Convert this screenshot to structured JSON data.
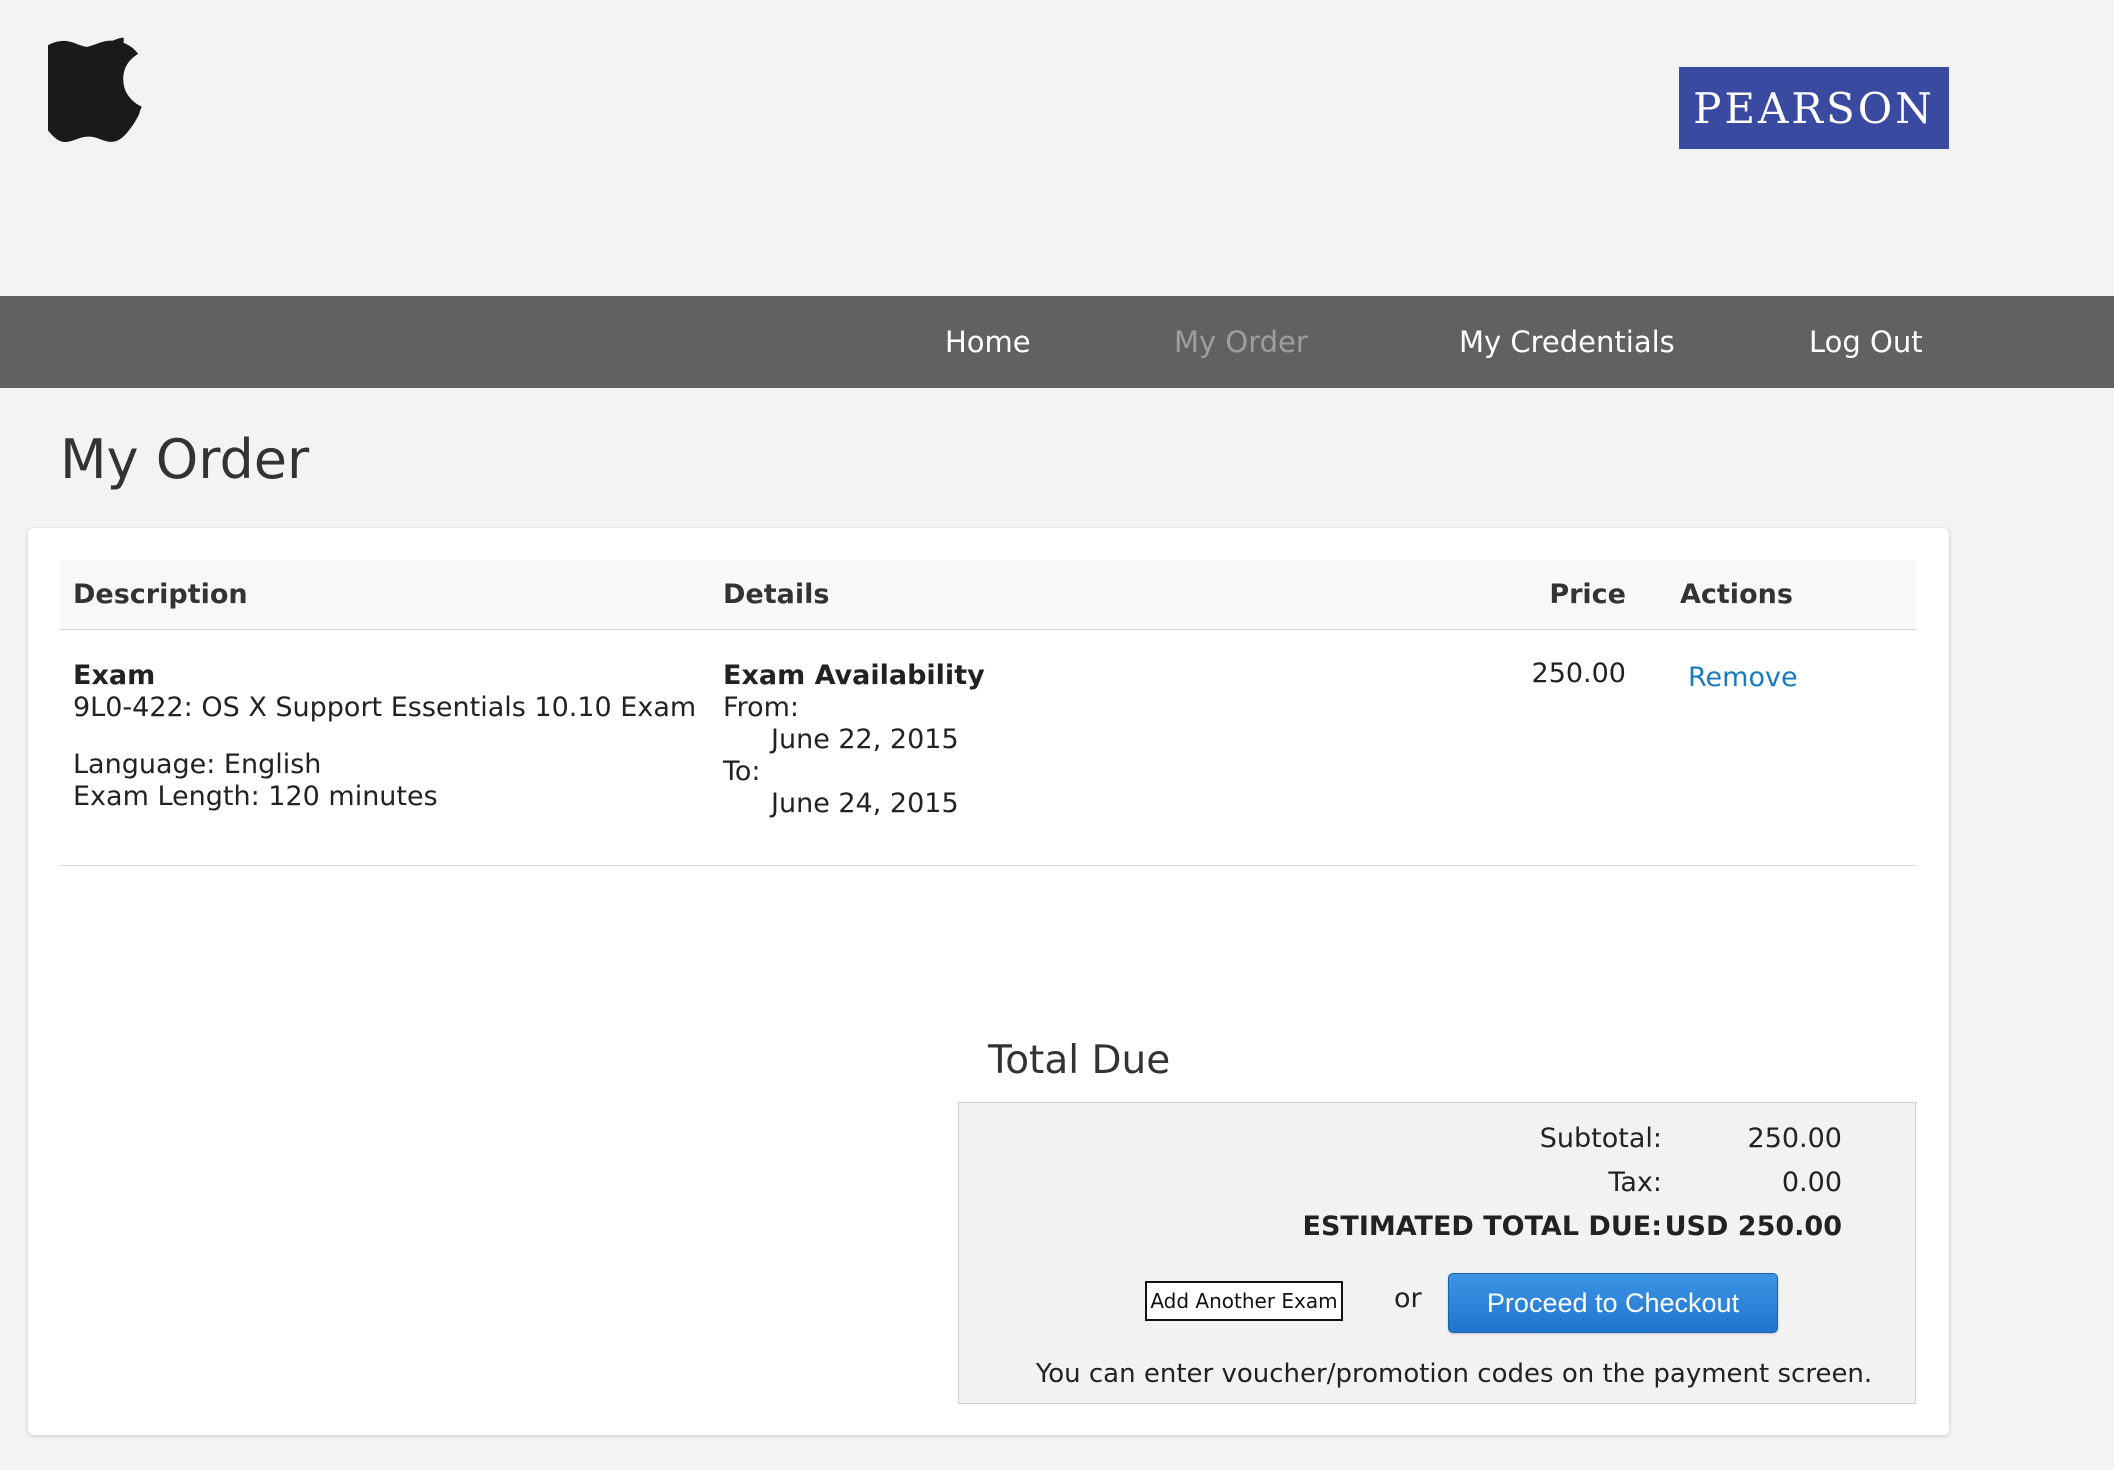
{
  "header": {
    "partner_logo_text": "PEARSON"
  },
  "nav": {
    "home": "Home",
    "my_order": "My Order",
    "my_credentials": "My Credentials",
    "log_out": "Log Out",
    "active": "my_order"
  },
  "page": {
    "title": "My Order"
  },
  "table": {
    "headers": {
      "description": "Description",
      "details": "Details",
      "price": "Price",
      "actions": "Actions"
    },
    "rows": [
      {
        "type": "Exam",
        "name": "9L0-422: OS X Support Essentials 10.10 Exam",
        "language": "Language: English",
        "length": "Exam Length: 120 minutes",
        "details_title": "Exam Availability",
        "from_label": "From:",
        "from_date": "June 22, 2015",
        "to_label": "To:",
        "to_date": "June 24, 2015",
        "price": "250.00",
        "action": "Remove"
      }
    ]
  },
  "total": {
    "title": "Total Due",
    "subtotal_label": "Subtotal:",
    "subtotal_value": "250.00",
    "tax_label": "Tax:",
    "tax_value": "0.00",
    "estimated_label": "ESTIMATED TOTAL DUE:",
    "estimated_value": "USD 250.00",
    "add_exam_label": "Add Another Exam",
    "or_text": "or",
    "checkout_label": "Proceed to Checkout",
    "voucher_note": "You can enter voucher/promotion codes on the payment screen."
  },
  "colors": {
    "nav_bg": "#616161",
    "pearson_blue": "#3a4aa0",
    "link_blue": "#1a7bbf",
    "checkout_blue": "#2a84da"
  },
  "icons": {
    "brand_logo": "apple-logo-icon"
  }
}
